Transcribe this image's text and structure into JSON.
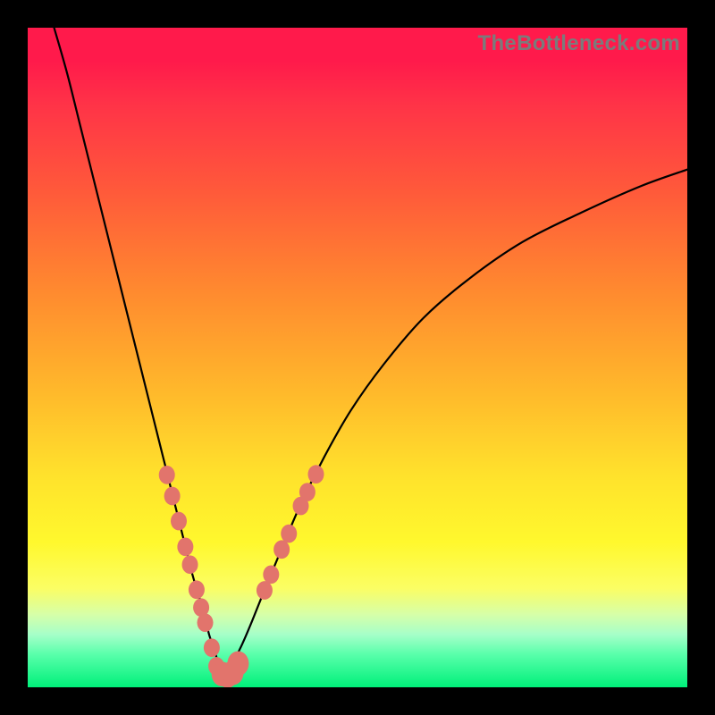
{
  "watermark": "TheBottleneck.com",
  "chart_data": {
    "type": "line",
    "title": "",
    "xlabel": "",
    "ylabel": "",
    "xlim": [
      0,
      100
    ],
    "ylim": [
      0,
      100
    ],
    "series": [
      {
        "name": "left-curve",
        "x": [
          4,
          6,
          8,
          10,
          12,
          14,
          16,
          18,
          20,
          22,
          23.5,
          25,
          26.5,
          27.5,
          28.5,
          29.2
        ],
        "y": [
          100,
          93,
          85,
          77,
          69,
          61,
          53,
          45,
          37,
          29,
          23,
          17,
          12,
          8,
          5,
          2
        ]
      },
      {
        "name": "right-curve",
        "x": [
          30,
          31,
          32.5,
          34,
          36,
          38.5,
          41.5,
          45,
          49,
          54,
          60,
          67,
          75,
          84,
          93,
          100
        ],
        "y": [
          1.5,
          3.5,
          6.5,
          10,
          15,
          21,
          28,
          35,
          42,
          49,
          56,
          62,
          67.5,
          72,
          76,
          78.5
        ]
      }
    ],
    "bottom_arc": {
      "name": "bottom-arc",
      "x": [
        28.5,
        29.2,
        29.8,
        30.3,
        30.8,
        31.3
      ],
      "y": [
        3.2,
        2.0,
        1.4,
        1.4,
        1.7,
        2.4
      ]
    },
    "markers_left": {
      "name": "markers-left",
      "points": [
        {
          "x": 21.1,
          "y": 32.2
        },
        {
          "x": 21.9,
          "y": 29.0
        },
        {
          "x": 22.9,
          "y": 25.2
        },
        {
          "x": 23.9,
          "y": 21.3
        },
        {
          "x": 24.6,
          "y": 18.6
        },
        {
          "x": 25.6,
          "y": 14.8
        },
        {
          "x": 26.3,
          "y": 12.1
        },
        {
          "x": 26.9,
          "y": 9.8
        },
        {
          "x": 27.9,
          "y": 6.0
        },
        {
          "x": 28.6,
          "y": 3.2
        }
      ]
    },
    "markers_right": {
      "name": "markers-right",
      "points": [
        {
          "x": 35.9,
          "y": 14.7
        },
        {
          "x": 36.9,
          "y": 17.1
        },
        {
          "x": 38.5,
          "y": 20.9
        },
        {
          "x": 39.6,
          "y": 23.3
        },
        {
          "x": 41.4,
          "y": 27.5
        },
        {
          "x": 42.4,
          "y": 29.6
        },
        {
          "x": 43.7,
          "y": 32.3
        }
      ]
    },
    "markers_bottom": {
      "name": "markers-bottom",
      "points": [
        {
          "x": 29.5,
          "y": 2.0
        },
        {
          "x": 30.3,
          "y": 1.8
        },
        {
          "x": 31.1,
          "y": 2.2
        },
        {
          "x": 31.9,
          "y": 3.6
        }
      ]
    },
    "marker_style": {
      "fill": "#e2746c",
      "r_small": 9,
      "r_large": 12
    }
  }
}
